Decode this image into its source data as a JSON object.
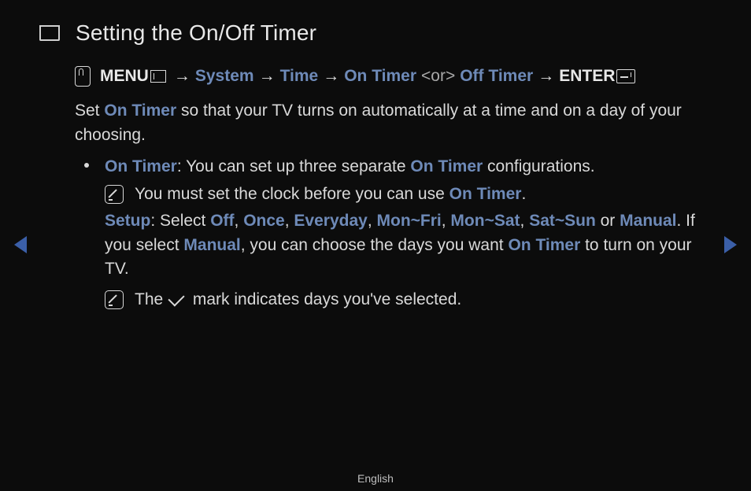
{
  "title": "Setting the On/Off Timer",
  "path": {
    "menu": "MENU",
    "system": "System",
    "time": "Time",
    "on_timer": "On Timer",
    "or": "<or>",
    "off_timer": "Off Timer",
    "enter": "ENTER",
    "arrow": "→"
  },
  "intro": {
    "p1a": "Set ",
    "p1_link": "On Timer",
    "p1b": " so that your TV turns on automatically at a time and on a day of your choosing."
  },
  "bullet": {
    "heading_link": "On Timer",
    "heading_rest_a": ": You can set up three separate ",
    "heading_link2": "On Timer",
    "heading_rest_b": " configurations.",
    "note1_a": "You must set the clock before you can use ",
    "note1_link": "On Timer",
    "note1_b": ".",
    "setup_label": "Setup",
    "setup_a": ": Select ",
    "opt_off": "Off",
    "sep": ", ",
    "opt_once": "Once",
    "opt_every": "Everyday",
    "opt_mf": "Mon~Fri",
    "opt_ms": "Mon~Sat",
    "opt_ss": "Sat~Sun",
    "or_word": " or ",
    "opt_manual": "Manual",
    "setup_b1": ". If you select ",
    "opt_manual2": "Manual",
    "setup_b2": ", you can choose the days you want ",
    "setup_link3": "On Timer",
    "setup_b3": " to turn on your TV.",
    "note2_a": "The ",
    "note2_b": " mark indicates days you've selected."
  },
  "footer": "English"
}
